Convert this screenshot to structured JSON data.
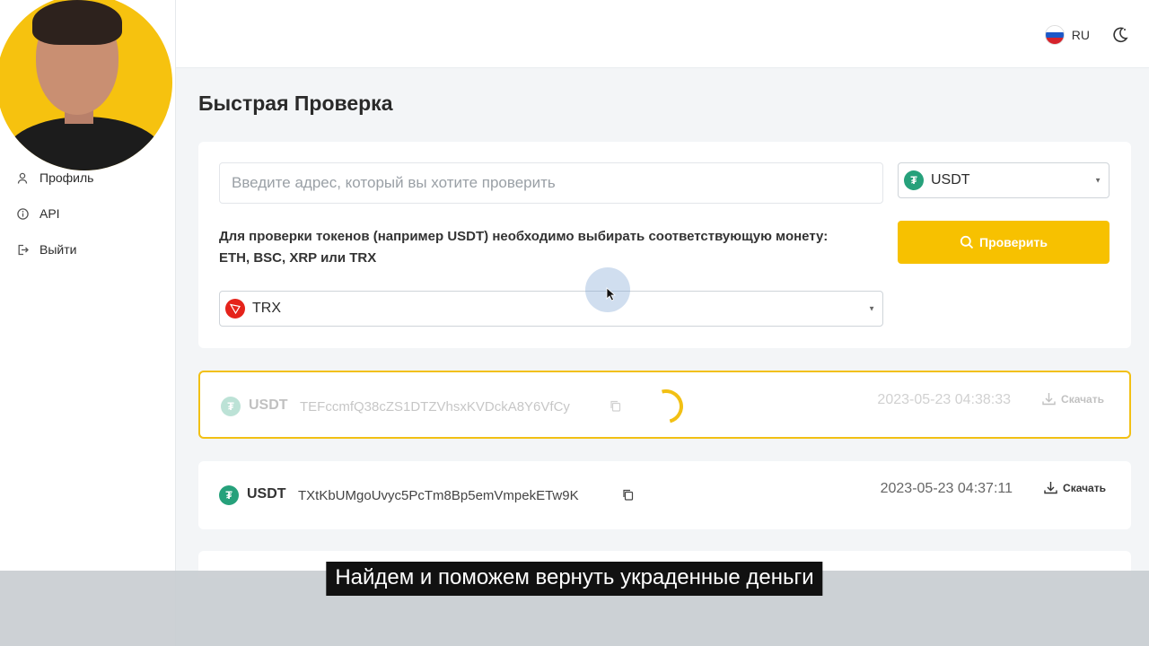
{
  "sidebar": {
    "items": [
      {
        "label": "Профиль",
        "icon": "user-icon"
      },
      {
        "label": "API",
        "icon": "info-icon"
      },
      {
        "label": "Выйти",
        "icon": "logout-icon"
      }
    ]
  },
  "header": {
    "language": "RU",
    "flag_colors": [
      "#ffffff",
      "#1c57c7",
      "#d5222b"
    ]
  },
  "page": {
    "title": "Быстрая Проверка"
  },
  "check_form": {
    "address_placeholder": "Введите адрес, который вы хотите проверить",
    "address_value": "",
    "coin": {
      "label": "USDT",
      "icon": "usdt-icon",
      "icon_glyph": "₮"
    },
    "notice": "Для проверки токенов (например USDT) необходимо выбирать соответствующую монету: ETH, BSC, XRP или TRX",
    "check_button": "Проверить",
    "chain": {
      "label": "TRX",
      "icon": "tron-icon"
    }
  },
  "results": [
    {
      "symbol": "USDT",
      "address": "TEFccmfQ38cZS1DTZVhsxKVDckA8Y6VfCy",
      "date": "2023-05-23 04:38:33",
      "download": "Скачать",
      "loading": true
    },
    {
      "symbol": "USDT",
      "address": "TXtKbUMgoUvyc5PcTm8Bp5emVmpekETw9K",
      "date": "2023-05-23 04:37:11",
      "download": "Скачать",
      "loading": false
    }
  ],
  "colors": {
    "accent": "#f7c100",
    "usdt": "#26a17b",
    "tron": "#e5231b"
  },
  "caption": "Найдем и поможем вернуть украденные деньги"
}
